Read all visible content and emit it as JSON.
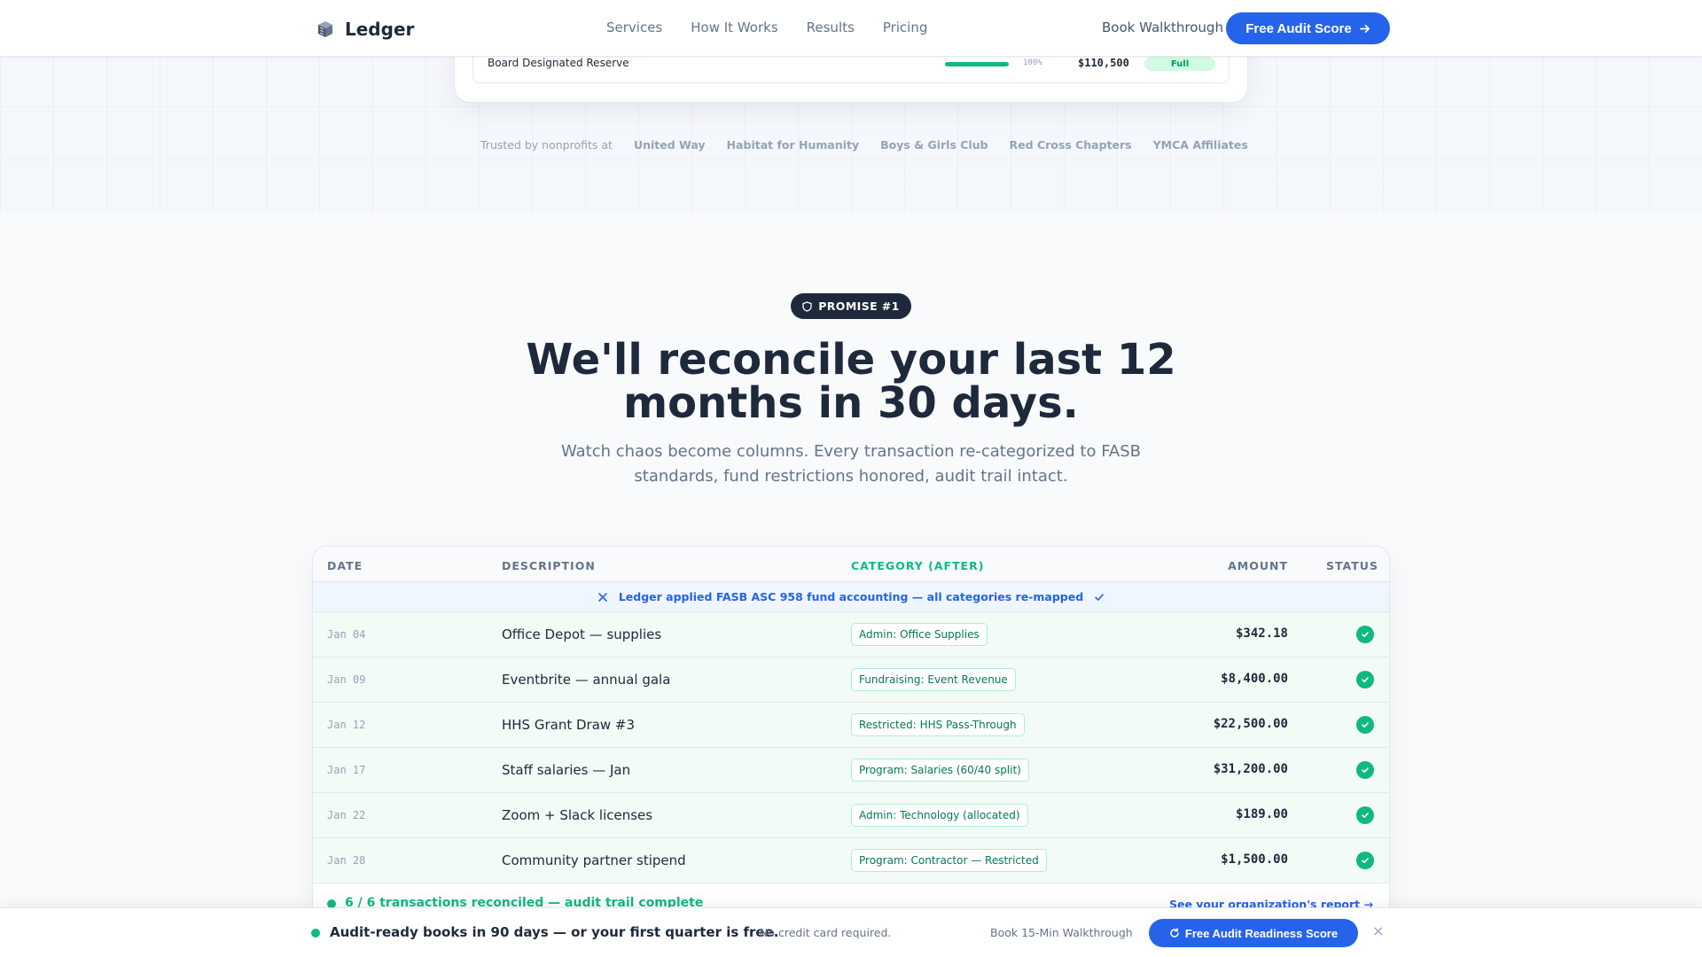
{
  "nav": {
    "brand": "Ledger",
    "links": [
      "Services",
      "How It Works",
      "Results",
      "Pricing"
    ],
    "walkthrough": "Book Walkthrough",
    "cta": "Free Audit Score"
  },
  "top_card": {
    "row_label": "Board Designated Reserve",
    "progress": 1.0,
    "percent": "100%",
    "amount": "$110,500",
    "badge": "Full"
  },
  "trusted": {
    "label": "Trusted by nonprofits at",
    "orgs": [
      "United Way",
      "Habitat for Humanity",
      "Boys & Girls Club",
      "Red Cross Chapters",
      "YMCA Affiliates"
    ]
  },
  "promise": {
    "pill": "PROMISE #1",
    "headline_line1": "We'll reconcile your last 12",
    "headline_line2": "months in 30 days.",
    "sub_line1": "Watch chaos become columns. Every transaction re-categorized to FASB",
    "sub_line2": "standards, fund restrictions honored, audit trail intact."
  },
  "table": {
    "headers": {
      "date": "DATE",
      "description": "DESCRIPTION",
      "category": "CATEGORY (AFTER)",
      "amount": "AMOUNT",
      "status": "STATUS"
    },
    "banner": "Ledger applied FASB ASC 958 fund accounting — all categories re-mapped",
    "rows": [
      {
        "date": "Jan 04",
        "description": "Office Depot — supplies",
        "category": "Admin: Office Supplies",
        "amount": "$342.18"
      },
      {
        "date": "Jan 09",
        "description": "Eventbrite — annual gala",
        "category": "Fundraising: Event Revenue",
        "amount": "$8,400.00"
      },
      {
        "date": "Jan 12",
        "description": "HHS Grant Draw #3",
        "category": "Restricted: HHS Pass-Through",
        "amount": "$22,500.00"
      },
      {
        "date": "Jan 17",
        "description": "Staff salaries — Jan",
        "category": "Program: Salaries (60/40 split)",
        "amount": "$31,200.00"
      },
      {
        "date": "Jan 22",
        "description": "Zoom + Slack licenses",
        "category": "Admin: Technology (allocated)",
        "amount": "$189.00"
      },
      {
        "date": "Jan 28",
        "description": "Community partner stipend",
        "category": "Program: Contractor — Restricted",
        "amount": "$1,500.00"
      }
    ],
    "footer_text": "6 / 6 transactions reconciled — audit trail complete",
    "footer_link": "See your organization's report"
  },
  "sticky": {
    "headline": "Audit-ready books in 90 days — or your first quarter is free.",
    "note": "No credit card required.",
    "walkthrough": "Book 15-Min Walkthrough",
    "cta": "Free Audit Readiness Score",
    "close": "×"
  },
  "colors": {
    "primary": "#2563eb",
    "success": "#10b981",
    "dark": "#1e293b"
  }
}
